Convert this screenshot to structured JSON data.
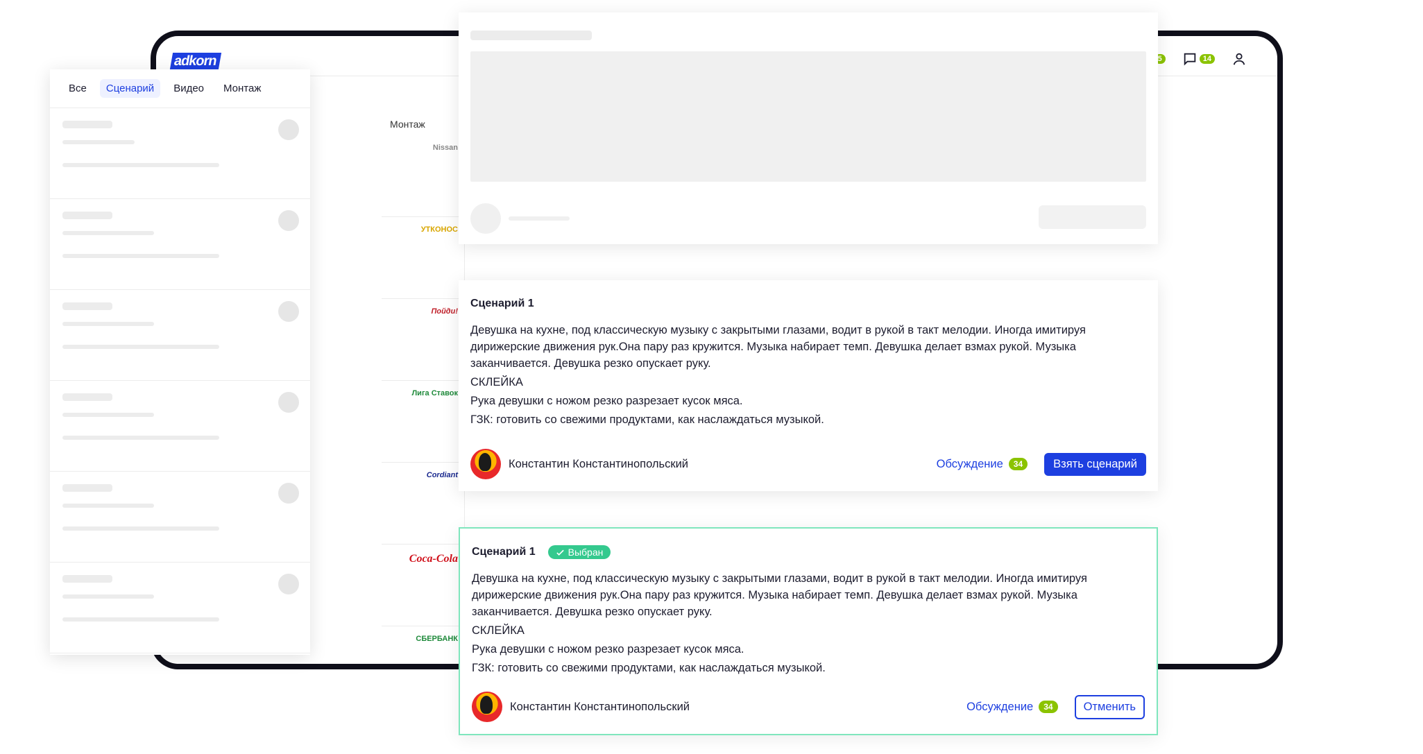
{
  "app": {
    "logo_text": "adkorn"
  },
  "header": {
    "notifications_count": "5",
    "messages_count": "14"
  },
  "tabs": [
    {
      "label": "Все"
    },
    {
      "label": "Сценарий",
      "active": true
    },
    {
      "label": "Видео"
    },
    {
      "label": "Монтаж"
    }
  ],
  "brand_column": {
    "header": "Монтаж",
    "brands": [
      "Nissan",
      "УТКОНОС",
      "Пойди!",
      "Лига Ставок",
      "Cordiant",
      "Coca-Cola",
      "СБЕРБАНК"
    ]
  },
  "cards": [
    {
      "title": "Сценарий 1",
      "selected": false,
      "paragraphs": [
        "Девушка на кухне, под классическую музыку с закрытыми глазами, водит в рукой в такт мелодии. Иногда имитируя дирижерские движения рук.Она пару раз кружится. Музыка набирает темп. Девушка делает взмах рукой. Музыка заканчивается. Девушка резко опускает руку.",
        "СКЛЕЙКА",
        "Рука девушки с ножом резко разрезает кусок мяса.",
        "ГЗК: готовить со свежими продуктами, как наслаждаться музыкой."
      ],
      "author": "Константин Константинопольский",
      "discussion_label": "Обсуждение",
      "discussion_count": "34",
      "action_label": "Взять сценарий"
    },
    {
      "title": "Сценарий 1",
      "selected": true,
      "badge": "Выбран",
      "paragraphs": [
        "Девушка на кухне, под классическую музыку с закрытыми глазами, водит в рукой в такт мелодии. Иногда имитируя дирижерские движения рук.Она пару раз кружится. Музыка набирает темп. Девушка делает взмах рукой. Музыка заканчивается. Девушка резко опускает руку.",
        "СКЛЕЙКА",
        "Рука девушки с ножом резко разрезает кусок мяса.",
        "ГЗК: готовить со свежими продуктами, как наслаждаться музыкой."
      ],
      "author": "Константин Константинопольский",
      "discussion_label": "Обсуждение",
      "discussion_count": "34",
      "action_label": "Отменить"
    }
  ],
  "colors": {
    "accent": "#1d3fe0",
    "count_badge": "#8bc300",
    "selected_badge": "#34c98e",
    "selected_border": "#7fe6bd"
  }
}
